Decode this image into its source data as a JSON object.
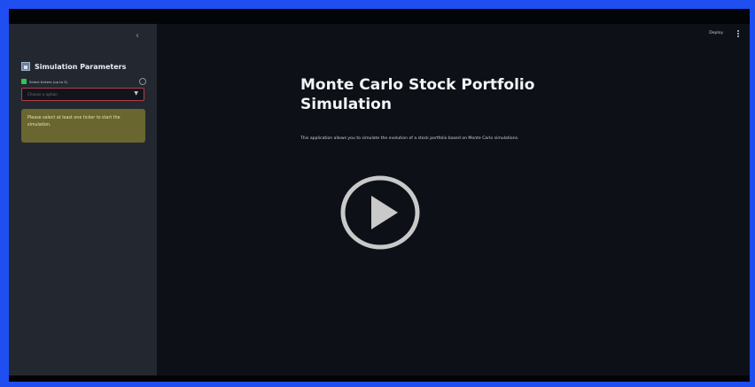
{
  "sidebar": {
    "collapse_icon": "chevron-left-icon",
    "title": "Simulation Parameters",
    "title_icon": "chart-icon",
    "ticker_label": "Select tickers (up to 5)",
    "ticker_placeholder": "Choose a option",
    "warning": "Please select at least one ticker to start the simulation."
  },
  "toolbar": {
    "deploy_label": "Deploy",
    "menu_icon": "more-vertical-icon"
  },
  "main": {
    "title": "Monte Carlo Stock Portfolio Simulation",
    "description": "This application allows you to simulate the evolution of a stock portfolio based on Monte Carlo simulations.",
    "overlay_icon": "play-icon"
  },
  "colors": {
    "frame_border": "#1f4ef0",
    "sidebar_bg": "#232830",
    "main_bg": "#0d1117",
    "warning_bg": "#69662f",
    "select_border": "#b33b4d"
  }
}
